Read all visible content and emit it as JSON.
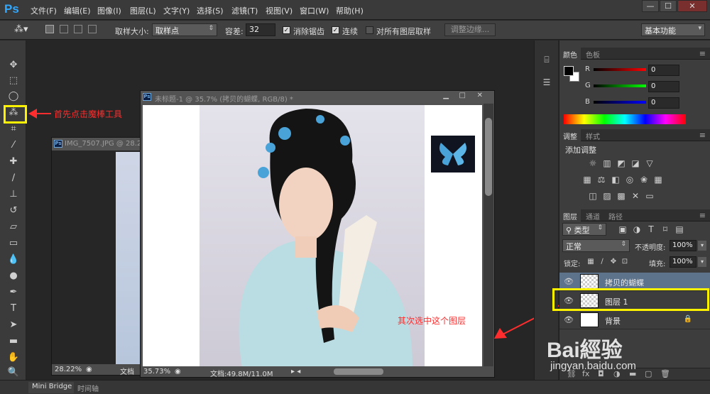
{
  "app": {
    "logo": "Ps"
  },
  "menu": [
    "文件(F)",
    "编辑(E)",
    "图像(I)",
    "图层(L)",
    "文字(Y)",
    "选择(S)",
    "滤镜(T)",
    "视图(V)",
    "窗口(W)",
    "帮助(H)"
  ],
  "window_controls": {
    "minimize": "—",
    "maximize": "☐",
    "close": "✕"
  },
  "options": {
    "sample_size_label": "取样大小:",
    "sample_size_value": "取样点",
    "tolerance_label": "容差:",
    "tolerance_value": "32",
    "antialias_label": "消除锯齿",
    "antialias_checked": true,
    "contiguous_label": "连续",
    "contiguous_checked": true,
    "all_layers_label": "对所有图层取样",
    "all_layers_checked": false,
    "refine_edge_label": "调整边缘...",
    "workspace_value": "基本功能"
  },
  "doc_back": {
    "title": "IMG_7507.JPG @ 28.2",
    "zoom": "28.22%",
    "doc_label": "文档"
  },
  "doc_front": {
    "title": "未标题-1 @ 35.7% (拷贝的蝴蝶, RGB/8) *",
    "zoom": "35.73%",
    "doc_info": "文档:49.8M/11.0M"
  },
  "color_panel": {
    "tabs": [
      "颜色",
      "色板"
    ],
    "channels": [
      {
        "label": "R",
        "value": "0",
        "color": "#d9202a"
      },
      {
        "label": "G",
        "value": "0",
        "color": "#27b33a"
      },
      {
        "label": "B",
        "value": "0",
        "color": "#2f4fd8"
      }
    ]
  },
  "adjust_panel": {
    "tabs": [
      "调整",
      "样式"
    ],
    "title": "添加调整"
  },
  "layers_panel": {
    "tabs": [
      "图层",
      "通道",
      "路径"
    ],
    "filter_label": "类型",
    "blend_mode": "正常",
    "opacity_label": "不透明度:",
    "opacity_value": "100%",
    "lock_label": "锁定:",
    "fill_label": "填充:",
    "fill_value": "100%",
    "layers": [
      {
        "name": "拷贝的蝴蝶",
        "selected": true
      },
      {
        "name": "图层 1",
        "selected": false
      },
      {
        "name": "背景",
        "selected": false
      }
    ]
  },
  "bottom_tabs": [
    "Mini Bridge",
    "时间轴"
  ],
  "annotations": {
    "magic_wand": "首先点击魔棒工具",
    "select_layer": "其次选中这个图层"
  },
  "watermark": {
    "text": "Bai經验",
    "url": "jingyan.baidu.com"
  }
}
